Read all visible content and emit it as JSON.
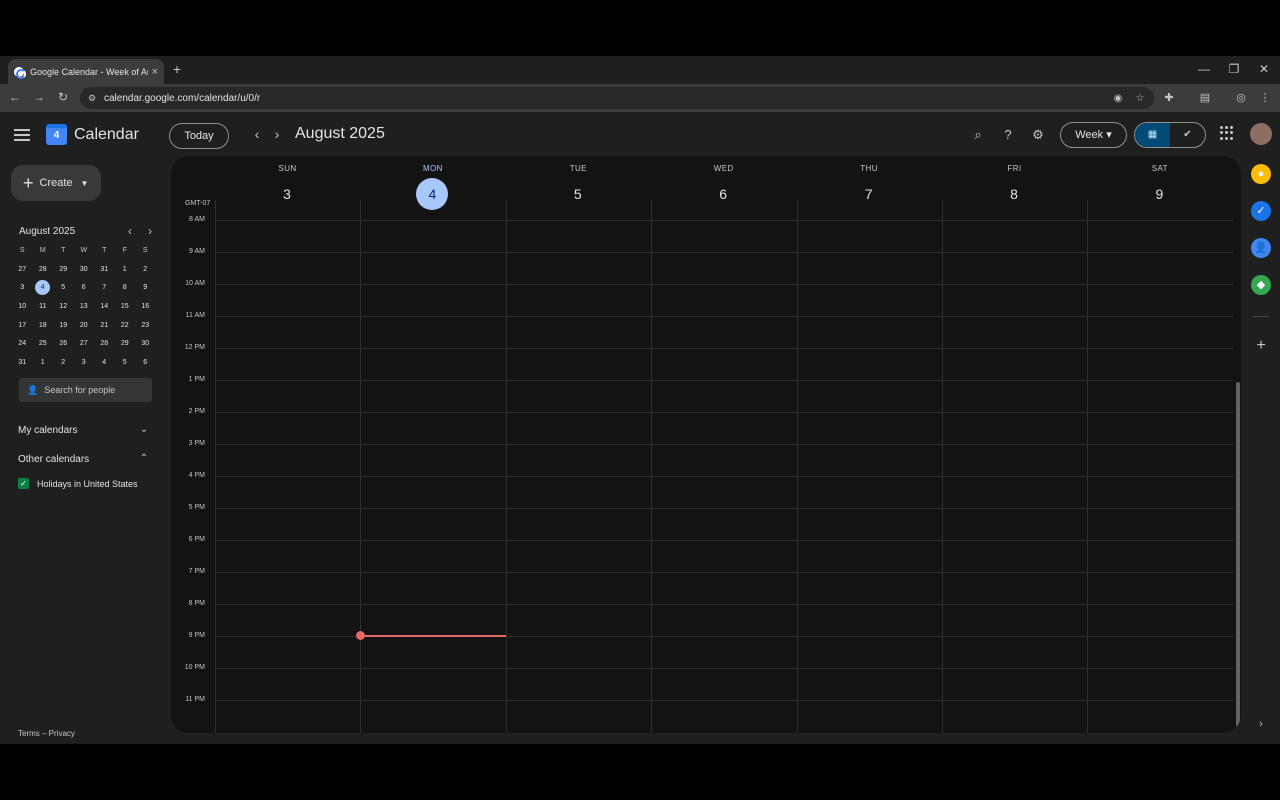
{
  "browser": {
    "tab_title": "Google Calendar - Week of Au",
    "tab_close": "×",
    "new_tab": "+",
    "url": "calendar.google.com/calendar/u/0/r",
    "window_controls": [
      "—",
      "❐",
      "✕"
    ]
  },
  "header": {
    "app_name": "Calendar",
    "logo_day": "4",
    "today_label": "Today",
    "prev": "‹",
    "next": "›",
    "month_title": "August 2025",
    "view_label": "Week",
    "view_caret": "▾",
    "seg_calendar": "▦",
    "seg_tasks": "✔"
  },
  "sidebar": {
    "create_label": "Create",
    "create_caret": "▼",
    "mini_cal": {
      "title": "August 2025",
      "prev": "‹",
      "next": "›",
      "dow": [
        "S",
        "M",
        "T",
        "W",
        "T",
        "F",
        "S"
      ],
      "weeks": [
        [
          "27",
          "28",
          "29",
          "30",
          "31",
          "1",
          "2"
        ],
        [
          "3",
          "4",
          "5",
          "6",
          "7",
          "8",
          "9"
        ],
        [
          "10",
          "11",
          "12",
          "13",
          "14",
          "15",
          "16"
        ],
        [
          "17",
          "18",
          "19",
          "20",
          "21",
          "22",
          "23"
        ],
        [
          "24",
          "25",
          "26",
          "27",
          "28",
          "29",
          "30"
        ],
        [
          "31",
          "1",
          "2",
          "3",
          "4",
          "5",
          "6"
        ]
      ],
      "today": "4"
    },
    "search_people_placeholder": "Search for people",
    "my_calendars": "My calendars",
    "other_calendars": "Other calendars",
    "holidays": "Holidays in United States",
    "footer": "Terms – Privacy"
  },
  "week": {
    "timezone": "GMT-07",
    "days": [
      {
        "name": "SUN",
        "num": "3",
        "active": false
      },
      {
        "name": "MON",
        "num": "4",
        "active": true
      },
      {
        "name": "TUE",
        "num": "5",
        "active": false
      },
      {
        "name": "WED",
        "num": "6",
        "active": false
      },
      {
        "name": "THU",
        "num": "7",
        "active": false
      },
      {
        "name": "FRI",
        "num": "8",
        "active": false
      },
      {
        "name": "SAT",
        "num": "9",
        "active": false
      }
    ],
    "hours": [
      "8 AM",
      "9 AM",
      "10 AM",
      "11 AM",
      "12 PM",
      "1 PM",
      "2 PM",
      "3 PM",
      "4 PM",
      "5 PM",
      "6 PM",
      "7 PM",
      "8 PM",
      "9 PM",
      "10 PM",
      "11 PM"
    ]
  },
  "colors": {
    "accent": "#a8c7fa",
    "now_line": "#e46962",
    "holiday_calendar": "#0b8043"
  }
}
